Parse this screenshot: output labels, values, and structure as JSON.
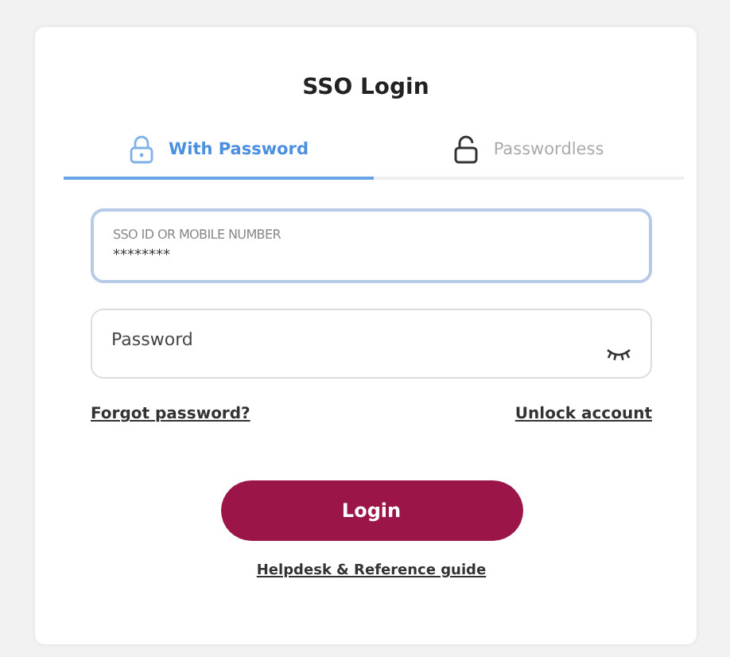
{
  "title": "SSO Login",
  "tabs": [
    {
      "label": "With Password",
      "kind": "lock",
      "selected": true
    },
    {
      "label": "Passwordless",
      "kind": "unlock",
      "selected": false
    }
  ],
  "fields": [
    {
      "label": "SSO ID OR MOBILE NUMBER",
      "value": "********",
      "focused": true
    },
    {
      "placeholder": "Password",
      "focused": false,
      "kind": "password"
    }
  ],
  "links": [
    "Forgot password?",
    "Unlock account"
  ],
  "login_button": "Login",
  "help_link": "Helpdesk & Reference guide"
}
